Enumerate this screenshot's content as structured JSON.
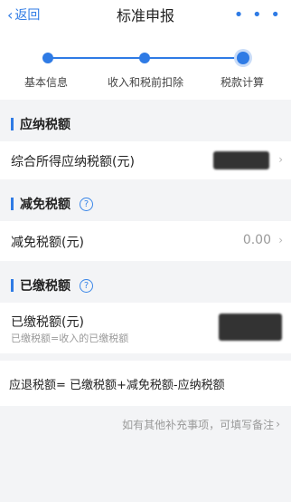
{
  "nav": {
    "back_label": "返回",
    "title": "标准申报",
    "more": "• • •"
  },
  "steps": [
    {
      "label": "基本信息"
    },
    {
      "label": "收入和税前扣除"
    },
    {
      "label": "税款计算"
    }
  ],
  "sections": {
    "payable": {
      "title": "应纳税额",
      "row_label": "综合所得应纳税额(元)"
    },
    "reduction": {
      "title": "减免税额",
      "help": "?",
      "row_label": "减免税额(元)",
      "row_value": "0.00"
    },
    "paid": {
      "title": "已缴税额",
      "help": "?",
      "row_label": "已缴税额(元)",
      "row_sub": "已缴税额=收入的已缴税额"
    }
  },
  "formula": "应退税额= 已缴税额+减免税额-应纳税额",
  "note": "如有其他补充事项，可填写备注",
  "colors": {
    "accent": "#2f7be5",
    "background": "#f3f4f6"
  }
}
